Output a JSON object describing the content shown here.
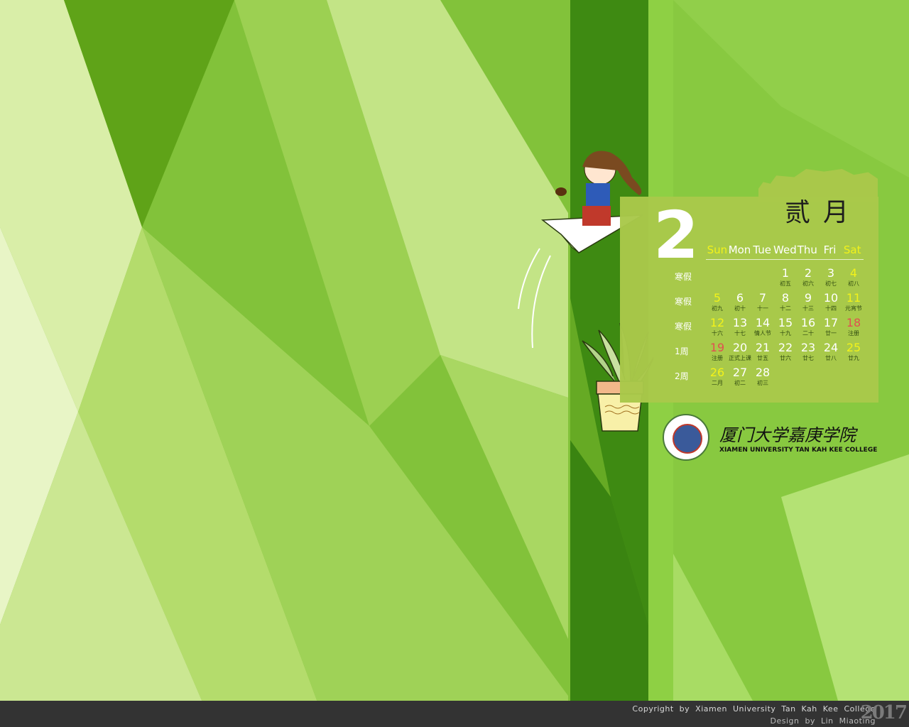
{
  "calendar": {
    "month_number": "2",
    "month_name_cn": "贰月",
    "weekdays": [
      "Sun",
      "Mon",
      "Tue",
      "Wed",
      "Thu",
      "Fri",
      "Sat"
    ],
    "weeks": [
      {
        "label": "寒假",
        "days": [
          null,
          null,
          null,
          {
            "d": "1",
            "l": "初五"
          },
          {
            "d": "2",
            "l": "初六"
          },
          {
            "d": "3",
            "l": "初七"
          },
          {
            "d": "4",
            "l": "初八",
            "c": "yellow"
          }
        ]
      },
      {
        "label": "寒假",
        "days": [
          {
            "d": "5",
            "l": "初九",
            "c": "yellow"
          },
          {
            "d": "6",
            "l": "初十"
          },
          {
            "d": "7",
            "l": "十一"
          },
          {
            "d": "8",
            "l": "十二"
          },
          {
            "d": "9",
            "l": "十三"
          },
          {
            "d": "10",
            "l": "十四"
          },
          {
            "d": "11",
            "l": "元宵节",
            "c": "yellow"
          }
        ]
      },
      {
        "label": "寒假",
        "days": [
          {
            "d": "12",
            "l": "十六",
            "c": "yellow"
          },
          {
            "d": "13",
            "l": "十七"
          },
          {
            "d": "14",
            "l": "情人节"
          },
          {
            "d": "15",
            "l": "十九"
          },
          {
            "d": "16",
            "l": "二十"
          },
          {
            "d": "17",
            "l": "廿一"
          },
          {
            "d": "18",
            "l": "注册",
            "c": "red"
          }
        ]
      },
      {
        "label": "1周",
        "days": [
          {
            "d": "19",
            "l": "注册",
            "c": "red"
          },
          {
            "d": "20",
            "l": "正式上课"
          },
          {
            "d": "21",
            "l": "廿五"
          },
          {
            "d": "22",
            "l": "廿六"
          },
          {
            "d": "23",
            "l": "廿七"
          },
          {
            "d": "24",
            "l": "廿八"
          },
          {
            "d": "25",
            "l": "廿九",
            "c": "yellow"
          }
        ]
      },
      {
        "label": "2周",
        "days": [
          {
            "d": "26",
            "l": "二月",
            "c": "yellow"
          },
          {
            "d": "27",
            "l": "初二"
          },
          {
            "d": "28",
            "l": "初三"
          },
          null,
          null,
          null,
          null
        ]
      }
    ]
  },
  "college": {
    "name_cn": "厦门大学嘉庚学院",
    "name_en": "XIAMEN UNIVERSITY TAN KAH KEE COLLEGE"
  },
  "footer": {
    "copyright": "Copyright by Xiamen University Tan Kah Kee College",
    "design": "Design by Lin Miaoting",
    "year": "2017"
  },
  "colors": {
    "highlight_yellow": "#f2f21a",
    "highlight_red": "#e05050",
    "panel": "#a9c84a"
  }
}
